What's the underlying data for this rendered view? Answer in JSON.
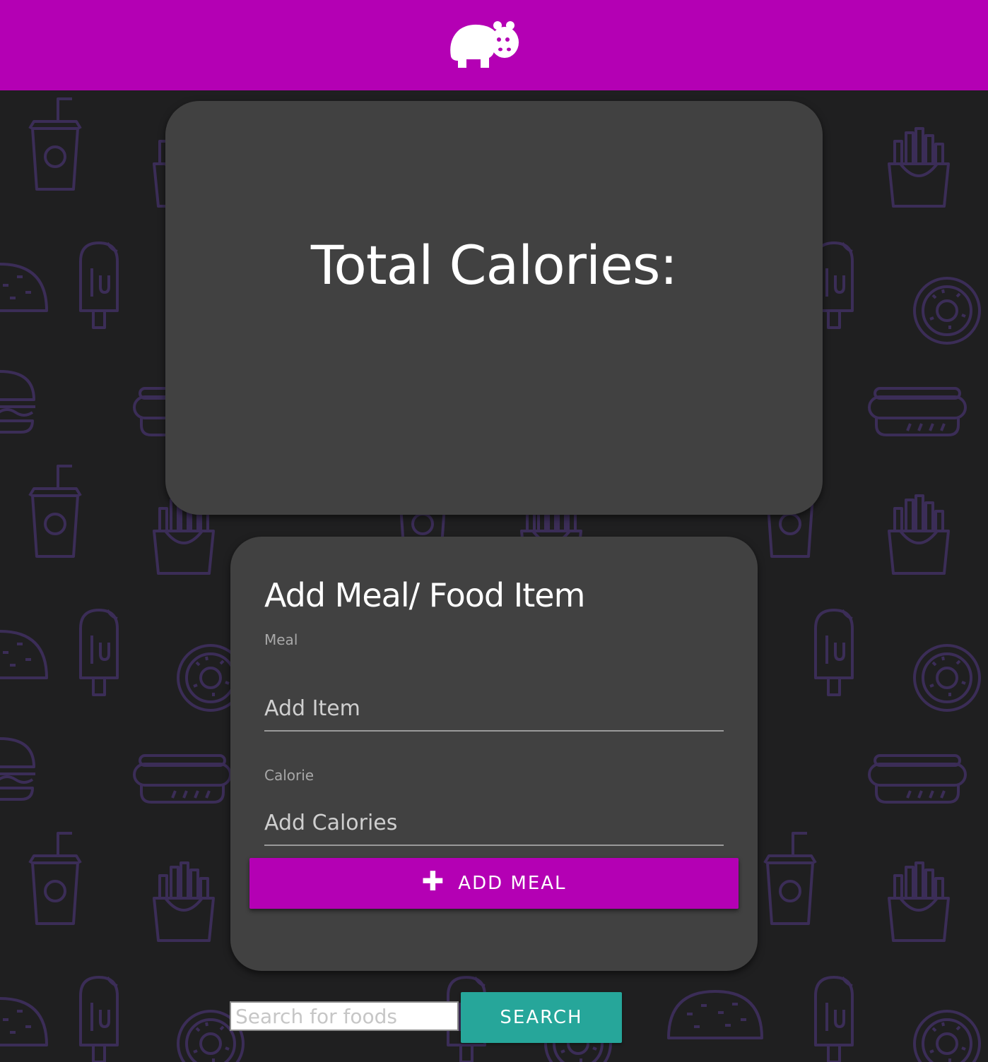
{
  "header": {
    "logo_icon": "hippo-icon",
    "brand_color": "#b400b4"
  },
  "total_card": {
    "title": "Total Calories:"
  },
  "form_card": {
    "title": "Add Meal/ Food Item",
    "meal_label": "Meal",
    "meal_placeholder": "Add Item",
    "calorie_label": "Calorie",
    "calorie_placeholder": "Add Calories",
    "add_button_icon": "plus-icon",
    "add_button_label": "ADD MEAL"
  },
  "search": {
    "placeholder": "Search for foods",
    "button_label": "SEARCH",
    "button_color": "#26a69a"
  },
  "background": {
    "pattern_icons": [
      "drink-cup-icon",
      "fries-icon",
      "popsicle-icon",
      "donut-icon",
      "burger-icon",
      "hotdog-icon",
      "taco-icon"
    ],
    "pattern_color": "#3a2c55"
  }
}
